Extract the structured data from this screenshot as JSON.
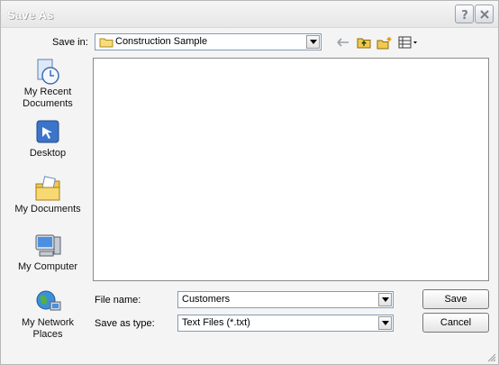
{
  "window": {
    "title": "Save As"
  },
  "save_in": {
    "label": "Save in:",
    "value": "Construction Sample"
  },
  "toolbar": {
    "back_icon": "back-arrow-icon",
    "up_icon": "up-folder-icon",
    "new_folder_icon": "new-folder-icon",
    "views_icon": "views-menu-icon"
  },
  "places": [
    {
      "label": "My Recent Documents",
      "icon": "recent-documents-icon"
    },
    {
      "label": "Desktop",
      "icon": "desktop-icon"
    },
    {
      "label": "My Documents",
      "icon": "my-documents-icon"
    },
    {
      "label": "My Computer",
      "icon": "my-computer-icon"
    },
    {
      "label": "My Network Places",
      "icon": "network-places-icon"
    }
  ],
  "file_name": {
    "label": "File name:",
    "value": "Customers"
  },
  "save_as_type": {
    "label": "Save as type:",
    "value": "Text Files (*.txt)"
  },
  "buttons": {
    "save": "Save",
    "cancel": "Cancel"
  },
  "colors": {
    "folder": "#f2c94c",
    "field_border": "#7f9db9"
  }
}
